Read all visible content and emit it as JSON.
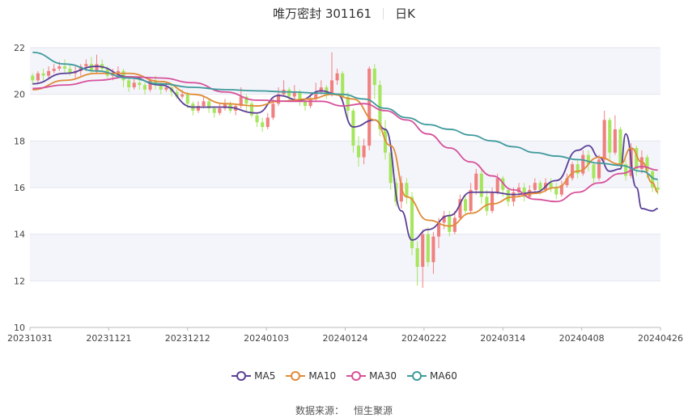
{
  "header": {
    "stock_name_code": "唯万密封 301161",
    "period": "日K"
  },
  "legend": [
    {
      "name": "MA5",
      "color": "#5b3f96"
    },
    {
      "name": "MA10",
      "color": "#e08b36"
    },
    {
      "name": "MA30",
      "color": "#d6509a"
    },
    {
      "name": "MA60",
      "color": "#3f9a9c"
    }
  ],
  "source": {
    "label": "数据来源：",
    "provider": "恒生聚源"
  },
  "chart_data": {
    "type": "candlestick",
    "ylim": [
      10,
      22
    ],
    "y_ticks": [
      10,
      12,
      14,
      16,
      18,
      20,
      22
    ],
    "x_ticks": [
      "20231031",
      "20231121",
      "20231212",
      "20240103",
      "20240124",
      "20240222",
      "20240314",
      "20240408",
      "20240426"
    ],
    "x_range_days": 118,
    "up_color": "#f08080",
    "down_color": "#a6e55e",
    "candles": [
      [
        0,
        20.8,
        20.6,
        20.9,
        20.4
      ],
      [
        1,
        20.6,
        20.9,
        21.0,
        20.5
      ],
      [
        2,
        20.9,
        20.8,
        21.1,
        20.6
      ],
      [
        3,
        20.8,
        21.0,
        21.2,
        20.7
      ],
      [
        4,
        21.0,
        21.1,
        21.3,
        20.9
      ],
      [
        5,
        21.1,
        21.2,
        21.4,
        21.0
      ],
      [
        6,
        21.2,
        21.1,
        21.5,
        20.9
      ],
      [
        7,
        21.1,
        20.9,
        21.3,
        20.8
      ],
      [
        8,
        20.9,
        21.0,
        21.2,
        20.7
      ],
      [
        9,
        21.0,
        21.2,
        21.3,
        20.8
      ],
      [
        10,
        21.2,
        21.3,
        21.5,
        21.0
      ],
      [
        11,
        21.3,
        21.0,
        21.6,
        20.9
      ],
      [
        12,
        21.0,
        21.3,
        21.7,
        20.9
      ],
      [
        13,
        21.3,
        21.1,
        21.5,
        21.0
      ],
      [
        14,
        21.1,
        20.8,
        21.2,
        20.7
      ],
      [
        15,
        20.8,
        20.9,
        21.1,
        20.6
      ],
      [
        16,
        20.9,
        21.0,
        21.2,
        20.7
      ],
      [
        17,
        21.0,
        20.6,
        21.1,
        20.3
      ],
      [
        18,
        20.6,
        20.3,
        20.7,
        20.1
      ],
      [
        19,
        20.3,
        20.5,
        20.7,
        20.2
      ],
      [
        20,
        20.5,
        20.4,
        20.8,
        20.2
      ],
      [
        21,
        20.4,
        20.2,
        20.5,
        20.0
      ],
      [
        22,
        20.2,
        20.6,
        20.7,
        20.1
      ],
      [
        23,
        20.6,
        20.4,
        20.8,
        20.2
      ],
      [
        24,
        20.4,
        20.2,
        20.5,
        20.0
      ],
      [
        25,
        20.2,
        20.3,
        20.5,
        20.1
      ],
      [
        26,
        20.3,
        20.1,
        20.4,
        19.9
      ],
      [
        27,
        20.1,
        19.9,
        20.2,
        19.8
      ],
      [
        28,
        19.9,
        20.0,
        20.2,
        19.8
      ],
      [
        29,
        20.0,
        19.6,
        20.1,
        19.4
      ],
      [
        30,
        19.6,
        19.3,
        19.7,
        19.1
      ],
      [
        31,
        19.3,
        19.5,
        19.7,
        19.2
      ],
      [
        32,
        19.5,
        19.7,
        19.9,
        19.4
      ],
      [
        33,
        19.7,
        19.4,
        19.8,
        19.2
      ],
      [
        34,
        19.4,
        19.2,
        19.5,
        19.0
      ],
      [
        35,
        19.2,
        19.4,
        19.6,
        19.1
      ],
      [
        36,
        19.4,
        19.6,
        19.8,
        19.3
      ],
      [
        37,
        19.6,
        19.3,
        19.7,
        19.2
      ],
      [
        38,
        19.3,
        19.5,
        19.6,
        19.1
      ],
      [
        39,
        19.5,
        19.9,
        20.3,
        19.4
      ],
      [
        40,
        19.9,
        19.6,
        20.0,
        19.3
      ],
      [
        41,
        19.6,
        19.1,
        19.7,
        19.0
      ],
      [
        42,
        19.1,
        18.8,
        19.2,
        18.6
      ],
      [
        43,
        18.8,
        18.6,
        19.0,
        18.4
      ],
      [
        44,
        18.6,
        19.0,
        19.2,
        18.5
      ],
      [
        45,
        19.0,
        19.6,
        19.8,
        18.9
      ],
      [
        46,
        19.6,
        20.0,
        20.3,
        19.5
      ],
      [
        47,
        20.0,
        20.2,
        20.6,
        19.9
      ],
      [
        48,
        20.2,
        19.9,
        20.3,
        19.7
      ],
      [
        49,
        19.9,
        20.1,
        20.4,
        19.8
      ],
      [
        50,
        20.1,
        19.7,
        20.2,
        19.5
      ],
      [
        51,
        19.7,
        19.5,
        19.8,
        19.3
      ],
      [
        52,
        19.5,
        19.8,
        20.0,
        19.4
      ],
      [
        53,
        19.8,
        20.1,
        20.5,
        19.7
      ],
      [
        54,
        20.1,
        20.3,
        20.6,
        20.0
      ],
      [
        55,
        20.3,
        20.0,
        20.4,
        19.8
      ],
      [
        56,
        20.0,
        20.6,
        21.8,
        19.9
      ],
      [
        57,
        20.6,
        20.9,
        21.1,
        20.4
      ],
      [
        58,
        20.9,
        19.9,
        21.0,
        19.7
      ],
      [
        59,
        19.9,
        19.3,
        20.1,
        18.9
      ],
      [
        60,
        19.3,
        17.8,
        19.4,
        17.5
      ],
      [
        61,
        17.8,
        17.3,
        18.2,
        16.9
      ],
      [
        62,
        17.3,
        17.8,
        18.1,
        17.0
      ],
      [
        63,
        17.8,
        21.1,
        21.2,
        17.6
      ],
      [
        64,
        21.1,
        20.4,
        21.3,
        19.8
      ],
      [
        65,
        20.4,
        18.5,
        20.6,
        18.2
      ],
      [
        66,
        18.5,
        17.5,
        18.9,
        17.2
      ],
      [
        67,
        17.5,
        16.2,
        17.7,
        15.9
      ],
      [
        68,
        16.2,
        15.4,
        16.4,
        15.2
      ],
      [
        69,
        15.4,
        16.2,
        16.5,
        15.1
      ],
      [
        70,
        16.2,
        15.6,
        16.4,
        15.3
      ],
      [
        71,
        15.6,
        13.4,
        15.8,
        13.1
      ],
      [
        72,
        13.4,
        12.6,
        13.7,
        11.8
      ],
      [
        73,
        12.6,
        14.0,
        14.2,
        11.7
      ],
      [
        74,
        14.0,
        12.8,
        14.3,
        12.6
      ],
      [
        75,
        12.8,
        13.9,
        14.1,
        12.3
      ],
      [
        76,
        13.9,
        14.5,
        14.7,
        13.4
      ],
      [
        77,
        14.5,
        14.8,
        15.0,
        14.2
      ],
      [
        78,
        14.8,
        14.1,
        15.0,
        13.9
      ],
      [
        79,
        14.1,
        14.7,
        15.0,
        14.0
      ],
      [
        80,
        14.7,
        15.5,
        15.7,
        14.6
      ],
      [
        81,
        15.5,
        15.0,
        15.7,
        14.8
      ],
      [
        82,
        15.0,
        15.9,
        16.2,
        14.9
      ],
      [
        83,
        15.9,
        16.6,
        16.8,
        15.7
      ],
      [
        84,
        16.6,
        15.6,
        16.8,
        15.3
      ],
      [
        85,
        15.6,
        15.0,
        15.9,
        14.8
      ],
      [
        86,
        15.0,
        15.8,
        16.0,
        14.9
      ],
      [
        87,
        15.8,
        16.4,
        16.6,
        15.7
      ],
      [
        88,
        16.4,
        15.9,
        16.5,
        15.6
      ],
      [
        89,
        15.9,
        15.4,
        16.0,
        15.2
      ],
      [
        90,
        15.4,
        15.8,
        16.0,
        15.2
      ],
      [
        91,
        15.8,
        16.0,
        16.2,
        15.6
      ],
      [
        92,
        16.0,
        15.6,
        16.2,
        15.4
      ],
      [
        93,
        15.6,
        15.9,
        16.1,
        15.5
      ],
      [
        94,
        15.9,
        16.2,
        16.4,
        15.8
      ],
      [
        95,
        16.2,
        15.9,
        16.3,
        15.7
      ],
      [
        96,
        15.9,
        16.2,
        16.4,
        15.8
      ],
      [
        97,
        16.2,
        16.0,
        16.4,
        15.8
      ],
      [
        98,
        16.0,
        15.7,
        16.2,
        15.5
      ],
      [
        99,
        15.7,
        16.1,
        16.3,
        15.6
      ],
      [
        100,
        16.1,
        16.4,
        16.6,
        16.0
      ],
      [
        101,
        16.4,
        17.0,
        17.1,
        16.3
      ],
      [
        102,
        17.0,
        16.6,
        17.2,
        16.4
      ],
      [
        103,
        16.6,
        17.4,
        17.6,
        16.5
      ],
      [
        104,
        17.4,
        17.0,
        17.6,
        16.7
      ],
      [
        105,
        17.0,
        16.4,
        17.1,
        16.2
      ],
      [
        106,
        16.4,
        17.2,
        17.4,
        16.3
      ],
      [
        107,
        17.2,
        18.9,
        19.3,
        17.1
      ],
      [
        108,
        18.9,
        17.5,
        19.0,
        17.2
      ],
      [
        109,
        17.5,
        18.5,
        19.1,
        17.4
      ],
      [
        110,
        18.5,
        17.0,
        18.6,
        16.8
      ],
      [
        111,
        17.0,
        16.5,
        17.2,
        16.3
      ],
      [
        112,
        16.5,
        17.7,
        17.9,
        16.4
      ],
      [
        113,
        17.7,
        16.8,
        17.8,
        16.5
      ],
      [
        114,
        16.8,
        17.3,
        17.6,
        16.6
      ],
      [
        115,
        17.3,
        16.7,
        17.4,
        16.4
      ],
      [
        116,
        16.7,
        16.0,
        16.8,
        15.8
      ],
      [
        117,
        16.0,
        15.9,
        16.3,
        15.7
      ]
    ],
    "ma_series": [
      {
        "name": "MA5",
        "points": [
          [
            0,
            20.45
          ],
          [
            6,
            20.9
          ],
          [
            12,
            21.2
          ],
          [
            18,
            20.75
          ],
          [
            24,
            20.4
          ],
          [
            30,
            19.45
          ],
          [
            36,
            19.45
          ],
          [
            42,
            19.2
          ],
          [
            46,
            19.95
          ],
          [
            50,
            19.75
          ],
          [
            54,
            20.15
          ],
          [
            57,
            20.0
          ],
          [
            60,
            18.6
          ],
          [
            64,
            18.9
          ],
          [
            66,
            18.5
          ],
          [
            69,
            15.0
          ],
          [
            71,
            13.75
          ],
          [
            74,
            14.2
          ],
          [
            78,
            14.8
          ],
          [
            82,
            15.8
          ],
          [
            86,
            15.8
          ],
          [
            90,
            15.7
          ],
          [
            94,
            15.8
          ],
          [
            98,
            16.3
          ],
          [
            102,
            17.6
          ],
          [
            104,
            17.8
          ],
          [
            106,
            17.3
          ],
          [
            108,
            16.7
          ],
          [
            110,
            16.8
          ],
          [
            111,
            18.3
          ],
          [
            113,
            16.0
          ],
          [
            114,
            15.1
          ],
          [
            116,
            15.0
          ],
          [
            117,
            15.1
          ]
        ]
      },
      {
        "name": "MA10",
        "points": [
          [
            0,
            20.2
          ],
          [
            6,
            20.6
          ],
          [
            12,
            20.9
          ],
          [
            18,
            20.9
          ],
          [
            24,
            20.55
          ],
          [
            30,
            20.0
          ],
          [
            36,
            19.6
          ],
          [
            42,
            19.5
          ],
          [
            46,
            19.7
          ],
          [
            52,
            19.8
          ],
          [
            56,
            20.0
          ],
          [
            60,
            19.8
          ],
          [
            64,
            18.9
          ],
          [
            67,
            17.8
          ],
          [
            70,
            15.6
          ],
          [
            74,
            14.6
          ],
          [
            78,
            14.35
          ],
          [
            82,
            14.9
          ],
          [
            86,
            15.3
          ],
          [
            90,
            15.6
          ],
          [
            94,
            15.75
          ],
          [
            98,
            16.0
          ],
          [
            102,
            16.7
          ],
          [
            106,
            17.3
          ],
          [
            110,
            17.0
          ],
          [
            112,
            17.7
          ],
          [
            114,
            17.1
          ],
          [
            116,
            16.2
          ],
          [
            117,
            15.8
          ]
        ]
      },
      {
        "name": "MA30",
        "points": [
          [
            0,
            20.25
          ],
          [
            6,
            20.4
          ],
          [
            12,
            20.6
          ],
          [
            18,
            20.75
          ],
          [
            24,
            20.7
          ],
          [
            30,
            20.5
          ],
          [
            36,
            20.1
          ],
          [
            42,
            19.75
          ],
          [
            48,
            19.7
          ],
          [
            54,
            19.7
          ],
          [
            58,
            19.5
          ],
          [
            62,
            19.6
          ],
          [
            66,
            19.3
          ],
          [
            70,
            18.9
          ],
          [
            74,
            18.3
          ],
          [
            78,
            17.7
          ],
          [
            82,
            17.1
          ],
          [
            86,
            16.5
          ],
          [
            90,
            15.9
          ],
          [
            94,
            15.5
          ],
          [
            98,
            15.4
          ],
          [
            102,
            15.8
          ],
          [
            106,
            16.2
          ],
          [
            110,
            16.6
          ],
          [
            114,
            16.9
          ],
          [
            117,
            16.75
          ]
        ]
      },
      {
        "name": "MA60",
        "points": [
          [
            0,
            21.8
          ],
          [
            6,
            21.3
          ],
          [
            12,
            21.0
          ],
          [
            18,
            20.7
          ],
          [
            24,
            20.45
          ],
          [
            30,
            20.3
          ],
          [
            36,
            20.2
          ],
          [
            42,
            20.15
          ],
          [
            48,
            20.1
          ],
          [
            54,
            20.05
          ],
          [
            58,
            20.0
          ],
          [
            62,
            19.8
          ],
          [
            66,
            19.4
          ],
          [
            70,
            19.0
          ],
          [
            74,
            18.7
          ],
          [
            78,
            18.5
          ],
          [
            82,
            18.25
          ],
          [
            86,
            18.0
          ],
          [
            90,
            17.75
          ],
          [
            94,
            17.5
          ],
          [
            98,
            17.35
          ],
          [
            102,
            17.2
          ],
          [
            106,
            17.05
          ],
          [
            110,
            16.95
          ],
          [
            114,
            16.7
          ],
          [
            117,
            16.35
          ]
        ]
      }
    ]
  }
}
